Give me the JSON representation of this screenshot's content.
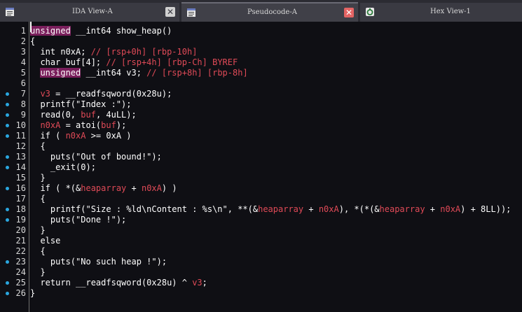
{
  "tabs": [
    {
      "title": "IDA View-A",
      "icon": "ida-view-icon",
      "close": "✕",
      "active": false,
      "close_color": "#d0d0d0"
    },
    {
      "title": "Pseudocode-A",
      "icon": "pseudocode-icon",
      "close": "✕",
      "active": true,
      "close_color": "#e46464"
    },
    {
      "title": "Hex View-1",
      "icon": "hex-view-icon",
      "active": false
    }
  ],
  "colors": {
    "keyword_bg": "#7a1f5c",
    "comment": "#e04a57",
    "variable": "#e04a57",
    "breakpoint": "#2aa7e0",
    "background": "#0f0f14"
  },
  "lines": [
    {
      "n": "1",
      "bp": false,
      "tokens": [
        [
          "kw",
          "unsigned"
        ],
        [
          "punc",
          " __int64 show_heap()"
        ]
      ]
    },
    {
      "n": "2",
      "bp": false,
      "tokens": [
        [
          "punc",
          "{"
        ]
      ]
    },
    {
      "n": "3",
      "bp": false,
      "tokens": [
        [
          "punc",
          "  int n0xA; "
        ],
        [
          "cmt",
          "// [rsp+0h] [rbp-10h]"
        ]
      ]
    },
    {
      "n": "4",
      "bp": false,
      "tokens": [
        [
          "punc",
          "  char buf[4]; "
        ],
        [
          "cmt",
          "// [rsp+4h] [rbp-Ch] BYREF"
        ]
      ]
    },
    {
      "n": "5",
      "bp": false,
      "tokens": [
        [
          "punc",
          "  "
        ],
        [
          "kw",
          "unsigned"
        ],
        [
          "punc",
          " __int64 v3; "
        ],
        [
          "cmt",
          "// [rsp+8h] [rbp-8h]"
        ]
      ]
    },
    {
      "n": "6",
      "bp": false,
      "tokens": []
    },
    {
      "n": "7",
      "bp": true,
      "tokens": [
        [
          "punc",
          "  "
        ],
        [
          "var",
          "v3"
        ],
        [
          "punc",
          " = __readfsqword(0x28u);"
        ]
      ]
    },
    {
      "n": "8",
      "bp": true,
      "tokens": [
        [
          "punc",
          "  printf(\"Index :\");"
        ]
      ]
    },
    {
      "n": "9",
      "bp": true,
      "tokens": [
        [
          "punc",
          "  read(0, "
        ],
        [
          "var",
          "buf"
        ],
        [
          "punc",
          ", 4uLL);"
        ]
      ]
    },
    {
      "n": "10",
      "bp": true,
      "tokens": [
        [
          "punc",
          "  "
        ],
        [
          "var",
          "n0xA"
        ],
        [
          "punc",
          " = atoi("
        ],
        [
          "var",
          "buf"
        ],
        [
          "punc",
          ");"
        ]
      ]
    },
    {
      "n": "11",
      "bp": true,
      "tokens": [
        [
          "punc",
          "  if ( "
        ],
        [
          "var",
          "n0xA"
        ],
        [
          "punc",
          " >= 0xA )"
        ]
      ]
    },
    {
      "n": "12",
      "bp": false,
      "tokens": [
        [
          "punc",
          "  {"
        ]
      ]
    },
    {
      "n": "13",
      "bp": true,
      "tokens": [
        [
          "punc",
          "    puts(\"Out of bound!\");"
        ]
      ]
    },
    {
      "n": "14",
      "bp": true,
      "tokens": [
        [
          "punc",
          "    _exit(0);"
        ]
      ]
    },
    {
      "n": "15",
      "bp": false,
      "tokens": [
        [
          "punc",
          "  }"
        ]
      ]
    },
    {
      "n": "16",
      "bp": true,
      "tokens": [
        [
          "punc",
          "  if ( *(&"
        ],
        [
          "gvar",
          "heaparray"
        ],
        [
          "punc",
          " + "
        ],
        [
          "var",
          "n0xA"
        ],
        [
          "punc",
          ") )"
        ]
      ]
    },
    {
      "n": "17",
      "bp": false,
      "tokens": [
        [
          "punc",
          "  {"
        ]
      ]
    },
    {
      "n": "18",
      "bp": true,
      "tokens": [
        [
          "punc",
          "    printf(\"Size : %ld\\nContent : %s\\n\", **(&"
        ],
        [
          "gvar",
          "heaparray"
        ],
        [
          "punc",
          " + "
        ],
        [
          "var",
          "n0xA"
        ],
        [
          "punc",
          "), *(*(&"
        ],
        [
          "gvar",
          "heaparray"
        ],
        [
          "punc",
          " + "
        ],
        [
          "var",
          "n0xA"
        ],
        [
          "punc",
          ") + 8LL));"
        ]
      ]
    },
    {
      "n": "19",
      "bp": true,
      "tokens": [
        [
          "punc",
          "    puts(\"Done !\");"
        ]
      ]
    },
    {
      "n": "20",
      "bp": false,
      "tokens": [
        [
          "punc",
          "  }"
        ]
      ]
    },
    {
      "n": "21",
      "bp": false,
      "tokens": [
        [
          "punc",
          "  else"
        ]
      ]
    },
    {
      "n": "22",
      "bp": false,
      "tokens": [
        [
          "punc",
          "  {"
        ]
      ]
    },
    {
      "n": "23",
      "bp": true,
      "tokens": [
        [
          "punc",
          "    puts(\"No such heap !\");"
        ]
      ]
    },
    {
      "n": "24",
      "bp": false,
      "tokens": [
        [
          "punc",
          "  }"
        ]
      ]
    },
    {
      "n": "25",
      "bp": true,
      "tokens": [
        [
          "punc",
          "  return __readfsqword(0x28u) ^ "
        ],
        [
          "var",
          "v3"
        ],
        [
          "punc",
          ";"
        ]
      ]
    },
    {
      "n": "26",
      "bp": true,
      "tokens": [
        [
          "punc",
          "}"
        ]
      ]
    }
  ]
}
